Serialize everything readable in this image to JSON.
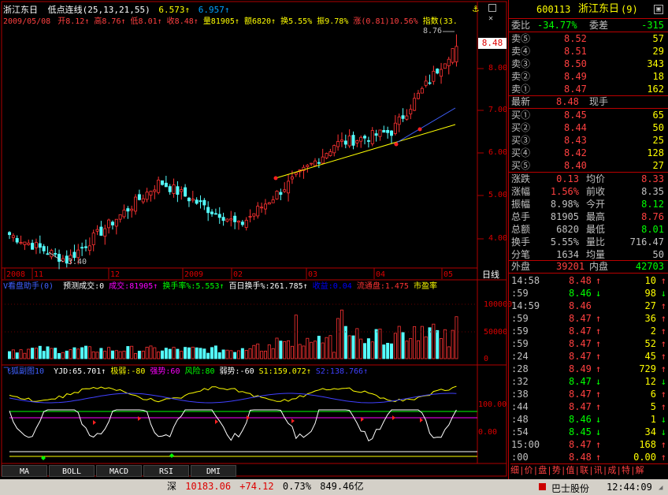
{
  "header": {
    "stock_name": "浙江东日",
    "indicator_title": "低点连线(25,13,21,55)",
    "indicator_v1": "6.573↑",
    "indicator_v2": "6.957↑",
    "date": "2009/05/08",
    "open": "开8.12↑",
    "high": "高8.76↑",
    "low": "低8.01↑",
    "close": "收8.48↑",
    "volume": "量81905↑",
    "amount": "额6820↑",
    "turnover": "换5.55%",
    "amplitude": "振9.78%",
    "change": "涨(0.81)10.56%",
    "index": "指数(33.",
    "high_marker": "8.76",
    "low_marker": "3.40"
  },
  "price_axis": {
    "ticks": [
      "8.00",
      "7.00",
      "6.00",
      "5.00",
      "4.00"
    ],
    "current": "8.48"
  },
  "date_axis": [
    "2008",
    "11",
    "12",
    "2009",
    "02",
    "03",
    "04",
    "05"
  ],
  "date_axis_unit": "日线",
  "volume_panel": {
    "title": "V看盘助手(0)",
    "items": [
      {
        "text": "预测成交:0",
        "color": "#ffffff"
      },
      {
        "text": "成交:81905↑",
        "color": "#ff00ff"
      },
      {
        "text": "换手率%:5.553↑",
        "color": "#00ff00"
      },
      {
        "text": "百日换手%:261.785↑",
        "color": "#ffffff"
      },
      {
        "text": "收益:0.04",
        "color": "#0000ff"
      },
      {
        "text": "流通盘:1.475",
        "color": "#ff3333"
      },
      {
        "text": "市盈率",
        "color": "#ffff00"
      }
    ],
    "axis": [
      "100000",
      "50000",
      "0"
    ]
  },
  "indicator_panel": {
    "title": "飞狐副图10",
    "items": [
      {
        "text": "YJD:65.701↑",
        "color": "#ffffff"
      },
      {
        "text": "极弱:-80",
        "color": "#ffff00"
      },
      {
        "text": "强势:60",
        "color": "#ff00ff"
      },
      {
        "text": "风险:80",
        "color": "#00ff00"
      },
      {
        "text": "弱势:-60",
        "color": "#ffffff"
      },
      {
        "text": "S1:159.072↑",
        "color": "#ffff00"
      },
      {
        "text": "S2:138.766↑",
        "color": "#4040ff"
      }
    ],
    "axis": [
      "100.00",
      "0.00"
    ]
  },
  "bottom_tabs": [
    "MA",
    "BOLL",
    "MACD",
    "RSI",
    "DMI"
  ],
  "quote": {
    "code": "600113",
    "name": "浙江东日",
    "tag": "(9)",
    "webi_label": "委比",
    "webi_value": "-34.77%",
    "weicha_label": "委差",
    "weicha_value": "-315",
    "sells": [
      {
        "label": "卖⑤",
        "price": "8.52",
        "vol": "57"
      },
      {
        "label": "卖④",
        "price": "8.51",
        "vol": "29"
      },
      {
        "label": "卖③",
        "price": "8.50",
        "vol": "343"
      },
      {
        "label": "卖②",
        "price": "8.49",
        "vol": "18"
      },
      {
        "label": "卖①",
        "price": "8.47",
        "vol": "162"
      }
    ],
    "latest_label": "最新",
    "latest_value": "8.48",
    "xianshou_label": "现手",
    "buys": [
      {
        "label": "买①",
        "price": "8.45",
        "vol": "65"
      },
      {
        "label": "买②",
        "price": "8.44",
        "vol": "50"
      },
      {
        "label": "买③",
        "price": "8.43",
        "vol": "25"
      },
      {
        "label": "买④",
        "price": "8.42",
        "vol": "128"
      },
      {
        "label": "买⑤",
        "price": "8.40",
        "vol": "27"
      }
    ],
    "stats": [
      {
        "l1": "涨跌",
        "v1": "0.13",
        "c1": "#ff4040",
        "l2": "均价",
        "v2": "8.33",
        "c2": "#ff4040"
      },
      {
        "l1": "涨幅",
        "v1": "1.56%",
        "c1": "#ff4040",
        "l2": "前收",
        "v2": "8.35",
        "c2": "#c0c0c0"
      },
      {
        "l1": "振幅",
        "v1": "8.98%",
        "c1": "#c0c0c0",
        "l2": "今开",
        "v2": "8.12",
        "c2": "#00ff00"
      },
      {
        "l1": "总手",
        "v1": "81905",
        "c1": "#c0c0c0",
        "l2": "最高",
        "v2": "8.76",
        "c2": "#ff4040"
      },
      {
        "l1": "总额",
        "v1": "6820",
        "c1": "#c0c0c0",
        "l2": "最低",
        "v2": "8.01",
        "c2": "#00ff00"
      },
      {
        "l1": "换手",
        "v1": "5.55%",
        "c1": "#c0c0c0",
        "l2": "量比",
        "v2": "716.47",
        "c2": "#c0c0c0"
      },
      {
        "l1": "分笔",
        "v1": "1634",
        "c1": "#c0c0c0",
        "l2": "均量",
        "v2": "50",
        "c2": "#c0c0c0"
      }
    ],
    "waipan_label": "外盘",
    "waipan_value": "39201",
    "neipan_label": "内盘",
    "neipan_value": "42703",
    "ticks": [
      {
        "time": "14:58",
        "price": "8.48",
        "dir": "↑",
        "vol": "10",
        "c": "#ff4040"
      },
      {
        "time": ":59",
        "price": "8.46",
        "dir": "↓",
        "vol": "98",
        "c": "#00ff00"
      },
      {
        "time": "14:59",
        "price": "8.46",
        "dir": "",
        "vol": "27",
        "c": "#ff4040"
      },
      {
        "time": ":59",
        "price": "8.47",
        "dir": "↑",
        "vol": "36",
        "c": "#ff4040"
      },
      {
        "time": ":59",
        "price": "8.47",
        "dir": "↑",
        "vol": "2",
        "c": "#ff4040"
      },
      {
        "time": ":59",
        "price": "8.47",
        "dir": "↑",
        "vol": "52",
        "c": "#ff4040"
      },
      {
        "time": ":24",
        "price": "8.47",
        "dir": "↑",
        "vol": "45",
        "c": "#ff4040"
      },
      {
        "time": ":28",
        "price": "8.49",
        "dir": "↑",
        "vol": "729",
        "c": "#ff4040"
      },
      {
        "time": ":32",
        "price": "8.47",
        "dir": "↓",
        "vol": "12",
        "c": "#00ff00"
      },
      {
        "time": ":38",
        "price": "8.47",
        "dir": "↑",
        "vol": "6",
        "c": "#ff4040"
      },
      {
        "time": ":44",
        "price": "8.47",
        "dir": "↑",
        "vol": "5",
        "c": "#ff4040"
      },
      {
        "time": ":48",
        "price": "8.46",
        "dir": "↓",
        "vol": "1",
        "c": "#00ff00"
      },
      {
        "time": ":54",
        "price": "8.45",
        "dir": "↓",
        "vol": "34",
        "c": "#00ff00"
      },
      {
        "time": "15:00",
        "price": "8.47",
        "dir": "↑",
        "vol": "168",
        "c": "#ff4040"
      },
      {
        "time": ":00",
        "price": "8.48",
        "dir": "↑",
        "vol": "0.00",
        "c": "#ff4040"
      }
    ],
    "bottom_tabs": "细|价|盘|势|值|联|讯|成|特|解"
  },
  "status": {
    "market": "深",
    "index_value": "10183.06",
    "index_change": "+74.12",
    "index_pct": "0.73%",
    "index_amount": "849.46亿",
    "broker": "巴士股份",
    "time": "12:44:09"
  }
}
